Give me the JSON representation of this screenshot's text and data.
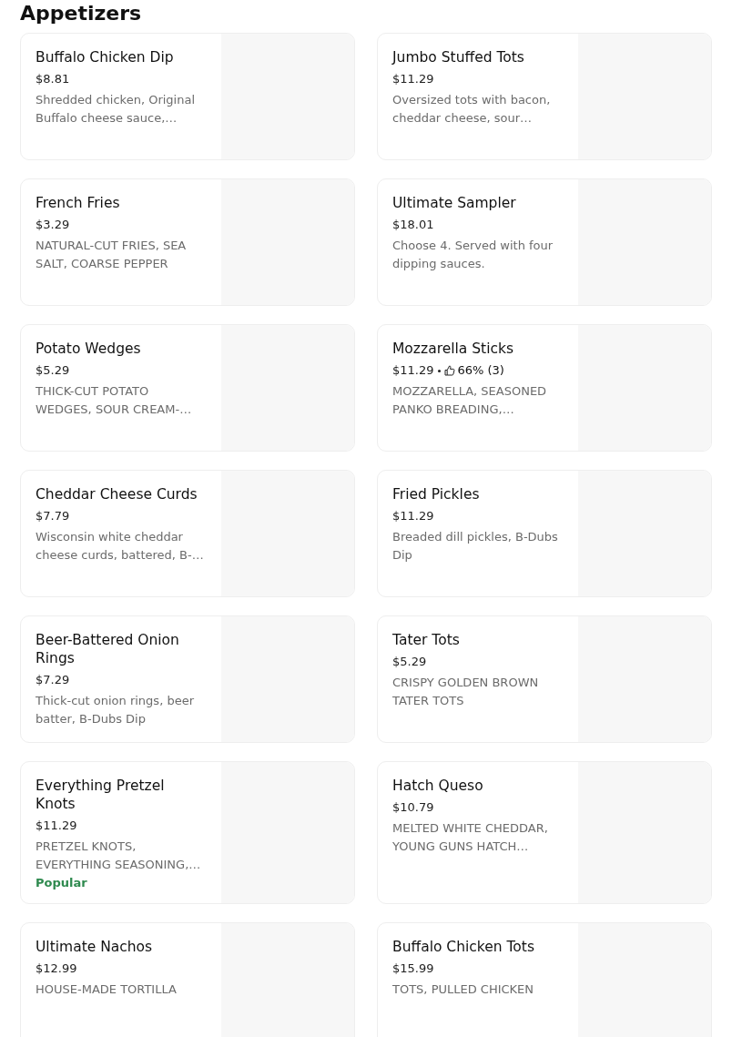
{
  "section": {
    "title": "Appetizers"
  },
  "items": [
    {
      "name": "Buffalo Chicken Dip",
      "price": "$8.81",
      "description": "Shredded chicken, Original Buffalo cheese sauce,…"
    },
    {
      "name": "Jumbo Stuffed Tots",
      "price": "$11.29",
      "description": "Oversized tots with bacon, cheddar cheese, sour…"
    },
    {
      "name": "French Fries",
      "price": "$3.29",
      "description": "NATURAL-CUT FRIES, SEA SALT, COARSE PEPPER"
    },
    {
      "name": "Ultimate Sampler",
      "price": "$18.01",
      "description": "Choose 4. Served with four dipping sauces."
    },
    {
      "name": "Potato Wedges",
      "price": "$5.29",
      "description": "THICK-CUT POTATO WEDGES, SOUR CREAM-…"
    },
    {
      "name": "Mozzarella Sticks",
      "price": "$11.29",
      "rating": "66% (3)",
      "description": "MOZZARELLA, SEASONED PANKO BREADING,…"
    },
    {
      "name": "Cheddar Cheese Curds",
      "price": "$7.79",
      "description": "Wisconsin white cheddar cheese curds, battered, B-…"
    },
    {
      "name": "Fried Pickles",
      "price": "$11.29",
      "description": "Breaded dill pickles, B-Dubs Dip"
    },
    {
      "name": "Beer-Battered Onion Rings",
      "price": "$7.29",
      "description": "Thick-cut onion rings, beer batter, B-Dubs Dip"
    },
    {
      "name": "Tater Tots",
      "price": "$5.29",
      "description": "CRISPY GOLDEN BROWN TATER TOTS"
    },
    {
      "name": "Everything Pretzel Knots",
      "price": "$11.29",
      "description": "PRETZEL KNOTS, EVERYTHING SEASONING,…",
      "badge": "Popular"
    },
    {
      "name": "Hatch Queso",
      "price": "$10.79",
      "description": "MELTED WHITE CHEDDAR, YOUNG GUNS HATCH…"
    },
    {
      "name": "Ultimate Nachos",
      "price": "$12.99",
      "description": "HOUSE-MADE TORTILLA"
    },
    {
      "name": "Buffalo Chicken Tots",
      "price": "$15.99",
      "description": "TOTS, PULLED CHICKEN"
    }
  ]
}
